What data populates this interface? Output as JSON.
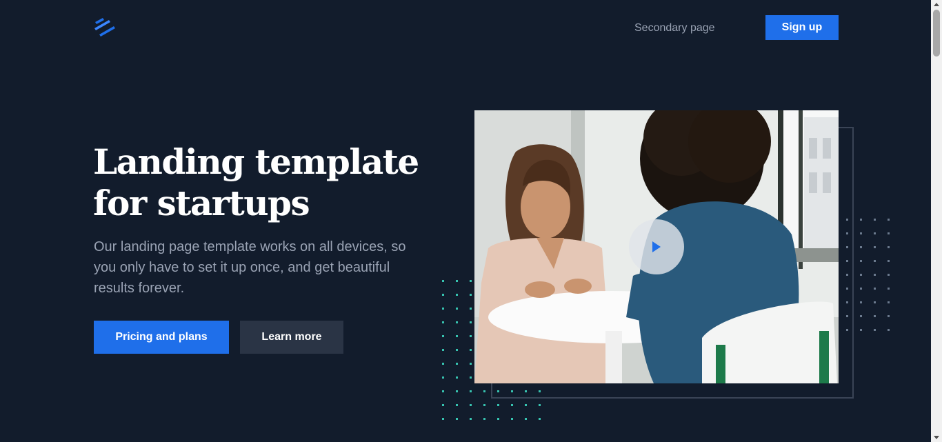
{
  "header": {
    "logo_icon": "stripes-logo",
    "nav_link": "Secondary page",
    "signup_label": "Sign up"
  },
  "hero": {
    "title_line1": "Landing template",
    "title_line2": "for startups",
    "description": "Our landing page template works on all devices, so you only have to set it up once, and get beautiful results forever.",
    "primary_cta": "Pricing and plans",
    "secondary_cta": "Learn more"
  },
  "media": {
    "image_alt": "Two women talking at a white table near a window",
    "play_icon": "play-icon"
  },
  "colors": {
    "background": "#121c2c",
    "accent": "#1f6fea",
    "secondary_button": "#2a3445",
    "muted_text": "#9aa3b4",
    "dots": "#37c3b0"
  }
}
